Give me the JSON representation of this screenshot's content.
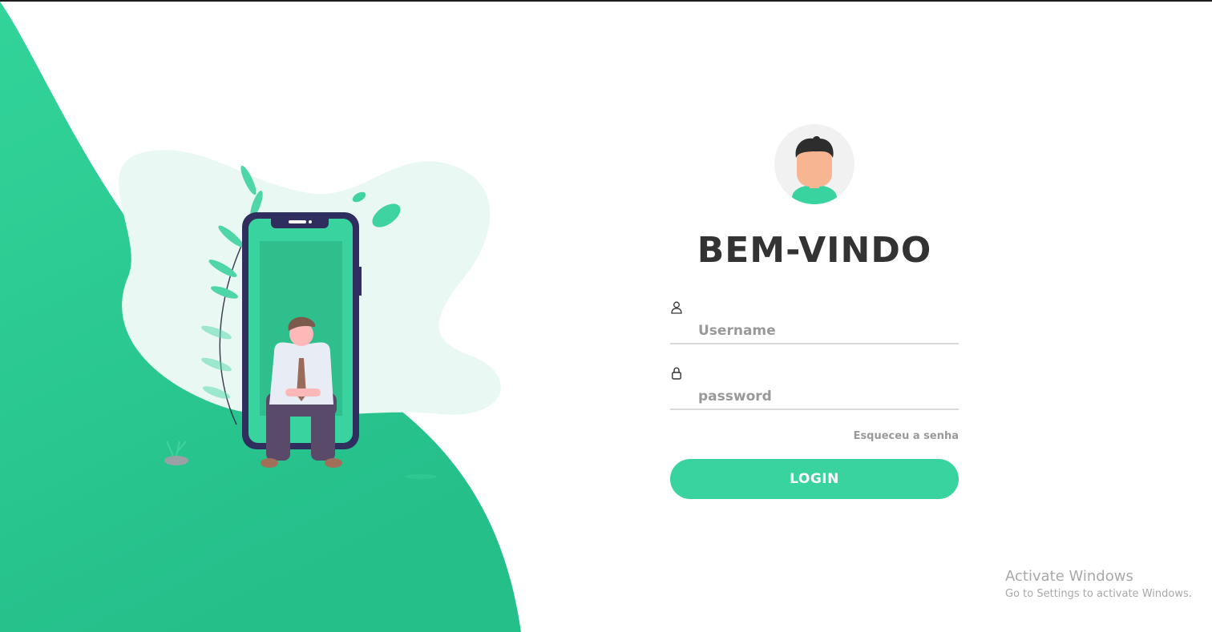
{
  "login": {
    "title": "BEM-VINDO",
    "username_placeholder": "Username",
    "password_placeholder": "password",
    "forgot_password": "Esqueceu a senha",
    "login_button": "LOGIN"
  },
  "icons": {
    "user": "user-icon",
    "lock": "lock-icon",
    "avatar": "avatar-icon"
  },
  "colors": {
    "accent": "#38d39f",
    "wave": "#2ecc94",
    "title": "#333333",
    "placeholder": "#999999"
  },
  "watermark": {
    "title": "Activate Windows",
    "subtitle": "Go to Settings to activate Windows."
  }
}
